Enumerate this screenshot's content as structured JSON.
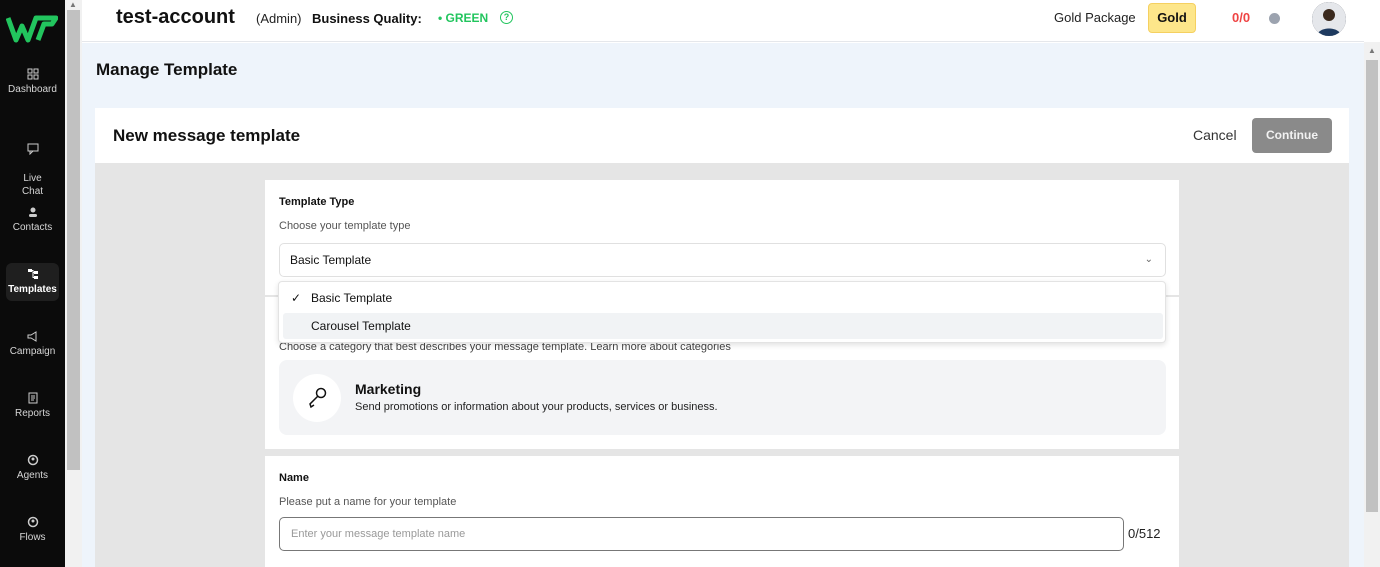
{
  "sidebar": {
    "items": [
      {
        "label": "Dashboard",
        "icon": "dashboard-icon"
      },
      {
        "label": "Live\nChat",
        "icon": "chat-icon"
      },
      {
        "label": "Contacts",
        "icon": "contacts-icon"
      },
      {
        "label": "Templates",
        "icon": "templates-icon",
        "active": true
      },
      {
        "label": "Campaign",
        "icon": "megaphone-icon"
      },
      {
        "label": "Reports",
        "icon": "reports-icon"
      },
      {
        "label": "Agents",
        "icon": "agents-icon"
      },
      {
        "label": "Flows",
        "icon": "flows-icon"
      }
    ]
  },
  "header": {
    "account": "test-account",
    "role": "(Admin)",
    "business_quality_label": "Business Quality:",
    "business_quality_value": "• GREEN",
    "package_label": "Gold Package",
    "package_badge": "Gold",
    "quota": "0/0"
  },
  "page": {
    "title": "Manage Template"
  },
  "panel": {
    "title": "New message template",
    "cancel": "Cancel",
    "continue": "Continue"
  },
  "template_type": {
    "title": "Template Type",
    "subtitle": "Choose your template type",
    "selected": "Basic Template",
    "options": [
      "Basic Template",
      "Carousel Template"
    ]
  },
  "category": {
    "subtitle": "Choose a category that best describes your message template. Learn more about categories",
    "option_title": "Marketing",
    "option_desc": "Send promotions or information about your products, services or business."
  },
  "name": {
    "title": "Name",
    "subtitle": "Please put a name for your template",
    "placeholder": "Enter your message template name",
    "counter": "0/512"
  },
  "colors": {
    "sidebar_bg": "#0b0b0b",
    "quality_green": "#22c55e",
    "gold_badge": "#fde68a",
    "quota_red": "#ef4444",
    "continue_disabled": "#8a8a8a"
  }
}
